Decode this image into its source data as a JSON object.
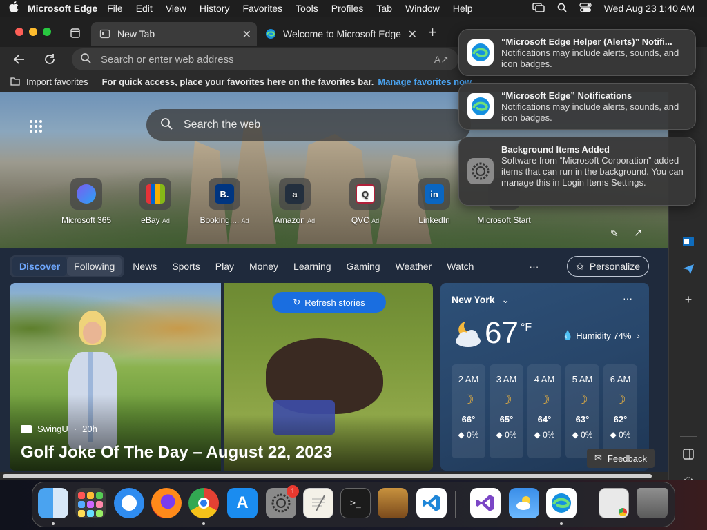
{
  "menubar": {
    "app_name": "Microsoft Edge",
    "menus": [
      "File",
      "Edit",
      "View",
      "History",
      "Favorites",
      "Tools",
      "Profiles",
      "Tab",
      "Window",
      "Help"
    ],
    "datetime": "Wed Aug 23  1:40 AM"
  },
  "tabs": [
    {
      "title": "New Tab"
    },
    {
      "title": "Welcome to Microsoft Edge"
    }
  ],
  "address": {
    "placeholder": "Search or enter web address"
  },
  "favorites": {
    "import_label": "Import favorites",
    "message": "For quick access, place your favorites here on the favorites bar.",
    "manage_link": "Manage favorites now"
  },
  "hero": {
    "search_placeholder": "Search the web",
    "quick_links": [
      {
        "label": "Microsoft 365",
        "ad": ""
      },
      {
        "label": "eBay",
        "ad": "Ad"
      },
      {
        "label": "Booking....",
        "ad": "Ad"
      },
      {
        "label": "Amazon",
        "ad": "Ad"
      },
      {
        "label": "QVC",
        "ad": "Ad"
      },
      {
        "label": "LinkedIn",
        "ad": ""
      },
      {
        "label": "Microsoft Start",
        "ad": ""
      }
    ]
  },
  "feed": {
    "pill_tabs": [
      "Discover",
      "Following"
    ],
    "nav": [
      "News",
      "Sports",
      "Play",
      "Money",
      "Learning",
      "Gaming",
      "Weather",
      "Watch"
    ],
    "more": "···",
    "personalize": "Personalize",
    "refresh": "Refresh stories",
    "story": {
      "source": "SwingU",
      "age": "20h",
      "headline": "Golf Joke Of The Day – August 22, 2023"
    },
    "feedback": "Feedback"
  },
  "weather": {
    "city": "New York",
    "temp": "67",
    "unit": "°F",
    "humidity": "Humidity 74%",
    "more": "···",
    "hours": [
      {
        "time": "2 AM",
        "temp": "66°",
        "precip": "0%"
      },
      {
        "time": "3 AM",
        "temp": "65°",
        "precip": "0%"
      },
      {
        "time": "4 AM",
        "temp": "64°",
        "precip": "0%"
      },
      {
        "time": "5 AM",
        "temp": "63°",
        "precip": "0%"
      },
      {
        "time": "6 AM",
        "temp": "62°",
        "precip": "0%"
      }
    ]
  },
  "notifications": [
    {
      "title": "“Microsoft Edge Helper (Alerts)” Notifi...",
      "body": "Notifications may include alerts, sounds, and icon badges."
    },
    {
      "title": "“Microsoft Edge” Notifications",
      "body": "Notifications may include alerts, sounds, and icon badges."
    },
    {
      "title": "Background Items Added",
      "body": "Software from “Microsoft Corporation” added items that can run in the background. You can manage this in Login Items Settings."
    }
  ],
  "dock": {
    "settings_badge": "1"
  },
  "colors": {
    "edge_blue": "#0f7bd8",
    "link": "#4aa3f0",
    "accent": "#1a73e8"
  }
}
